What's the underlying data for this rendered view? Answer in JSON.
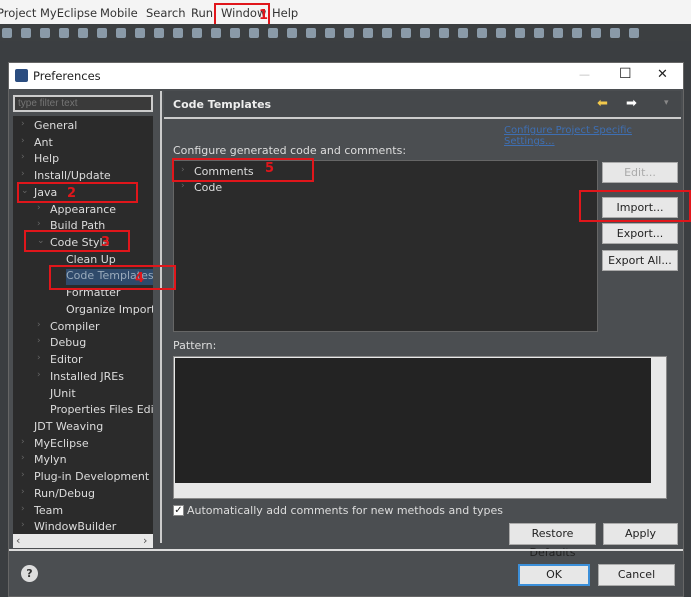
{
  "menubar": {
    "items": [
      "Project",
      "MyEclipse",
      "Mobile",
      "Search",
      "Run",
      "Window",
      "Help"
    ]
  },
  "dialog": {
    "title": "Preferences",
    "minimize": "—",
    "maximize": "☐",
    "close": "✕",
    "filter_placeholder": "type filter text",
    "tree": [
      {
        "label": "General",
        "level": 0,
        "expander": "›"
      },
      {
        "label": "Ant",
        "level": 0,
        "expander": "›"
      },
      {
        "label": "Help",
        "level": 0,
        "expander": "›"
      },
      {
        "label": "Install/Update",
        "level": 0,
        "expander": "›"
      },
      {
        "label": "Java",
        "level": 0,
        "expander": "⌄"
      },
      {
        "label": "Appearance",
        "level": 1,
        "expander": "›"
      },
      {
        "label": "Build Path",
        "level": 1,
        "expander": "›"
      },
      {
        "label": "Code Style",
        "level": 1,
        "expander": "⌄"
      },
      {
        "label": "Clean Up",
        "level": 2,
        "expander": ""
      },
      {
        "label": "Code Templates",
        "level": 2,
        "expander": "",
        "selected": true
      },
      {
        "label": "Formatter",
        "level": 2,
        "expander": ""
      },
      {
        "label": "Organize Imports",
        "level": 2,
        "expander": ""
      },
      {
        "label": "Compiler",
        "level": 1,
        "expander": "›"
      },
      {
        "label": "Debug",
        "level": 1,
        "expander": "›"
      },
      {
        "label": "Editor",
        "level": 1,
        "expander": "›"
      },
      {
        "label": "Installed JREs",
        "level": 1,
        "expander": "›"
      },
      {
        "label": "JUnit",
        "level": 1,
        "expander": ""
      },
      {
        "label": "Properties Files Editor",
        "level": 1,
        "expander": ""
      },
      {
        "label": "JDT Weaving",
        "level": 0,
        "expander": ""
      },
      {
        "label": "MyEclipse",
        "level": 0,
        "expander": "›"
      },
      {
        "label": "Mylyn",
        "level": 0,
        "expander": "›"
      },
      {
        "label": "Plug-in Development",
        "level": 0,
        "expander": "›"
      },
      {
        "label": "Run/Debug",
        "level": 0,
        "expander": "›"
      },
      {
        "label": "Team",
        "level": 0,
        "expander": "›"
      },
      {
        "label": "WindowBuilder",
        "level": 0,
        "expander": "›"
      }
    ],
    "page_title": "Code Templates",
    "project_link": "Configure Project Specific Settings...",
    "configure_label": "Configure generated code and comments:",
    "templates": [
      {
        "label": "Comments",
        "expander": "›"
      },
      {
        "label": "Code",
        "expander": "›"
      }
    ],
    "buttons": {
      "edit": "Edit...",
      "import": "Import...",
      "export": "Export...",
      "export_all": "Export All...",
      "restore": "Restore Defaults",
      "apply": "Apply",
      "ok": "OK",
      "cancel": "Cancel"
    },
    "pattern_label": "Pattern:",
    "auto_comments_label": "Automatically add comments for new methods and types",
    "auto_comments_checked": true,
    "help_icon": "?"
  },
  "annotations": [
    "1",
    "2",
    "3",
    "4",
    "5"
  ],
  "colors": {
    "annotation": "#e0161b",
    "selection": "#2f4a6b"
  }
}
